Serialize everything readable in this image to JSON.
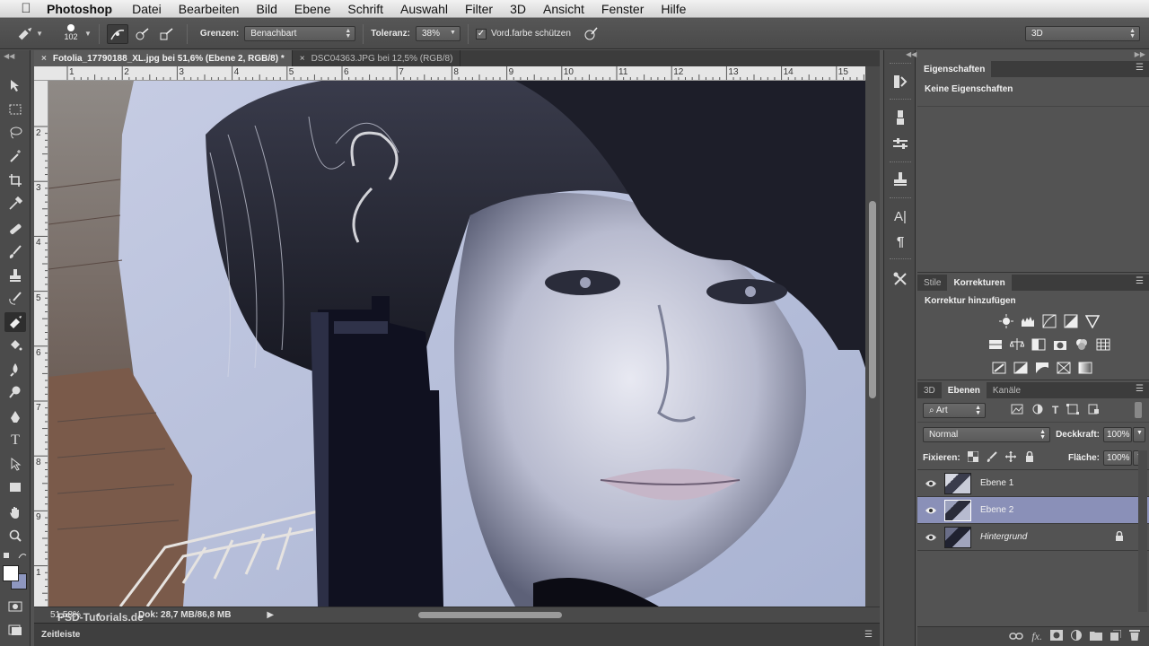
{
  "menubar": {
    "app_name": "Photoshop",
    "items": [
      "Datei",
      "Bearbeiten",
      "Bild",
      "Ebene",
      "Schrift",
      "Auswahl",
      "Filter",
      "3D",
      "Ansicht",
      "Fenster",
      "Hilfe"
    ]
  },
  "options_bar": {
    "brush_size": "102",
    "grenzen_label": "Grenzen:",
    "grenzen_value": "Benachbart",
    "toleranz_label": "Toleranz:",
    "toleranz_value": "38%",
    "protect_label": "Vord.farbe schützen",
    "protect_checked": true,
    "workspace_value": "3D"
  },
  "tabs": [
    {
      "label": "Fotolia_17790188_XL.jpg bei 51,6% (Ebene 2, RGB/8) *",
      "active": true
    },
    {
      "label": "DSC04363.JPG bei 12,5% (RGB/8)",
      "active": false
    }
  ],
  "rulers": {
    "horizontal": [
      "1",
      "2",
      "3",
      "4",
      "5",
      "6",
      "7",
      "8",
      "9",
      "10",
      "11",
      "12",
      "13",
      "14",
      "15"
    ],
    "vertical": [
      "2",
      "3",
      "4",
      "5",
      "6",
      "7",
      "8",
      "9",
      "1"
    ]
  },
  "status_bar": {
    "zoom": "51,58%",
    "doc_info": "Dok: 28,7 MB/86,8 MB",
    "timeline_label": "Zeitleiste",
    "watermark": "PSD-Tutorials.de"
  },
  "properties_panel": {
    "tab": "Eigenschaften",
    "content": "Keine Eigenschaften"
  },
  "adjustments_panel": {
    "tabs": [
      "Stile",
      "Korrekturen"
    ],
    "active_tab": "Korrekturen",
    "heading": "Korrektur hinzufügen"
  },
  "layers_panel": {
    "tabs": [
      "3D",
      "Ebenen",
      "Kanäle"
    ],
    "active_tab": "Ebenen",
    "filter_kind": "Art",
    "blend_mode": "Normal",
    "opacity_label": "Deckkraft:",
    "opacity_value": "100%",
    "lock_label": "Fixieren:",
    "fill_label": "Fläche:",
    "fill_value": "100%",
    "layers": [
      {
        "name": "Ebene 1",
        "selected": false,
        "locked": false
      },
      {
        "name": "Ebene 2",
        "selected": true,
        "locked": false
      },
      {
        "name": "Hintergrund",
        "selected": false,
        "locked": true
      }
    ]
  },
  "colors": {
    "menubar_bg": "#e4e4e4",
    "ui_dark": "#535353",
    "selection": "#8a90b8"
  }
}
